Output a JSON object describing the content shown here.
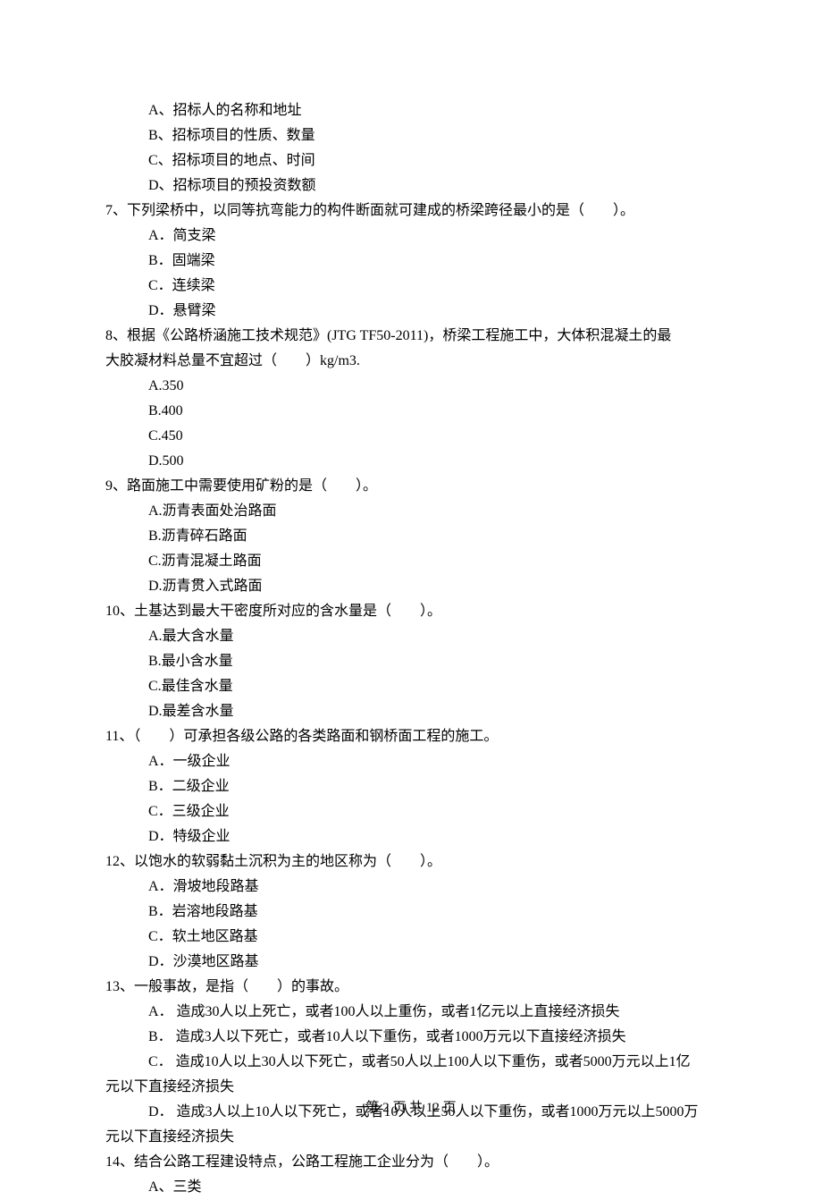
{
  "options_6": {
    "a": "A、招标人的名称和地址",
    "b": "B、招标项目的性质、数量",
    "c": "C、招标项目的地点、时间",
    "d": "D、招标项目的预投资数额"
  },
  "q7": {
    "text": "7、下列梁桥中，以同等抗弯能力的构件断面就可建成的桥梁跨径最小的是（　　）。",
    "a": "A．简支梁",
    "b": "B．固端梁",
    "c": "C．连续梁",
    "d": "D．悬臂梁"
  },
  "q8": {
    "text_1": "8、根据《公路桥涵施工技术规范》(JTG TF50-2011)，桥梁工程施工中，大体积混凝土的最",
    "text_2": "大胶凝材料总量不宜超过（　　）kg/m3.",
    "a": "A.350",
    "b": "B.400",
    "c": "C.450",
    "d": "D.500"
  },
  "q9": {
    "text": "9、路面施工中需要使用矿粉的是（　　）。",
    "a": "A.沥青表面处治路面",
    "b": "B.沥青碎石路面",
    "c": "C.沥青混凝土路面",
    "d": "D.沥青贯入式路面"
  },
  "q10": {
    "text": "10、土基达到最大干密度所对应的含水量是（　　）。",
    "a": "A.最大含水量",
    "b": "B.最小含水量",
    "c": "C.最佳含水量",
    "d": "D.最差含水量"
  },
  "q11": {
    "text": "11、（　　）可承担各级公路的各类路面和钢桥面工程的施工。",
    "a": "A．一级企业",
    "b": "B．二级企业",
    "c": "C．三级企业",
    "d": "D．特级企业"
  },
  "q12": {
    "text": "12、以饱水的软弱黏土沉积为主的地区称为（　　）。",
    "a": "A．滑坡地段路基",
    "b": "B．岩溶地段路基",
    "c": "C．软土地区路基",
    "d": "D．沙漠地区路基"
  },
  "q13": {
    "text": "13、一般事故，是指（　　）的事故。",
    "a": "A． 造成30人以上死亡，或者100人以上重伤，或者1亿元以上直接经济损失",
    "b": "B． 造成3人以下死亡，或者10人以下重伤，或者1000万元以下直接经济损失",
    "c_1": "C． 造成10人以上30人以下死亡，或者50人以上100人以下重伤，或者5000万元以上1亿",
    "c_2": "元以下直接经济损失",
    "d_1": "D． 造成3人以上10人以下死亡，或者10人以上50人以下重伤，或者1000万元以上5000万",
    "d_2": "元以下直接经济损失"
  },
  "q14": {
    "text": "14、结合公路工程建设特点，公路工程施工企业分为（　　）。",
    "a": "A、三类"
  },
  "footer": "第 2 页 共 12 页"
}
